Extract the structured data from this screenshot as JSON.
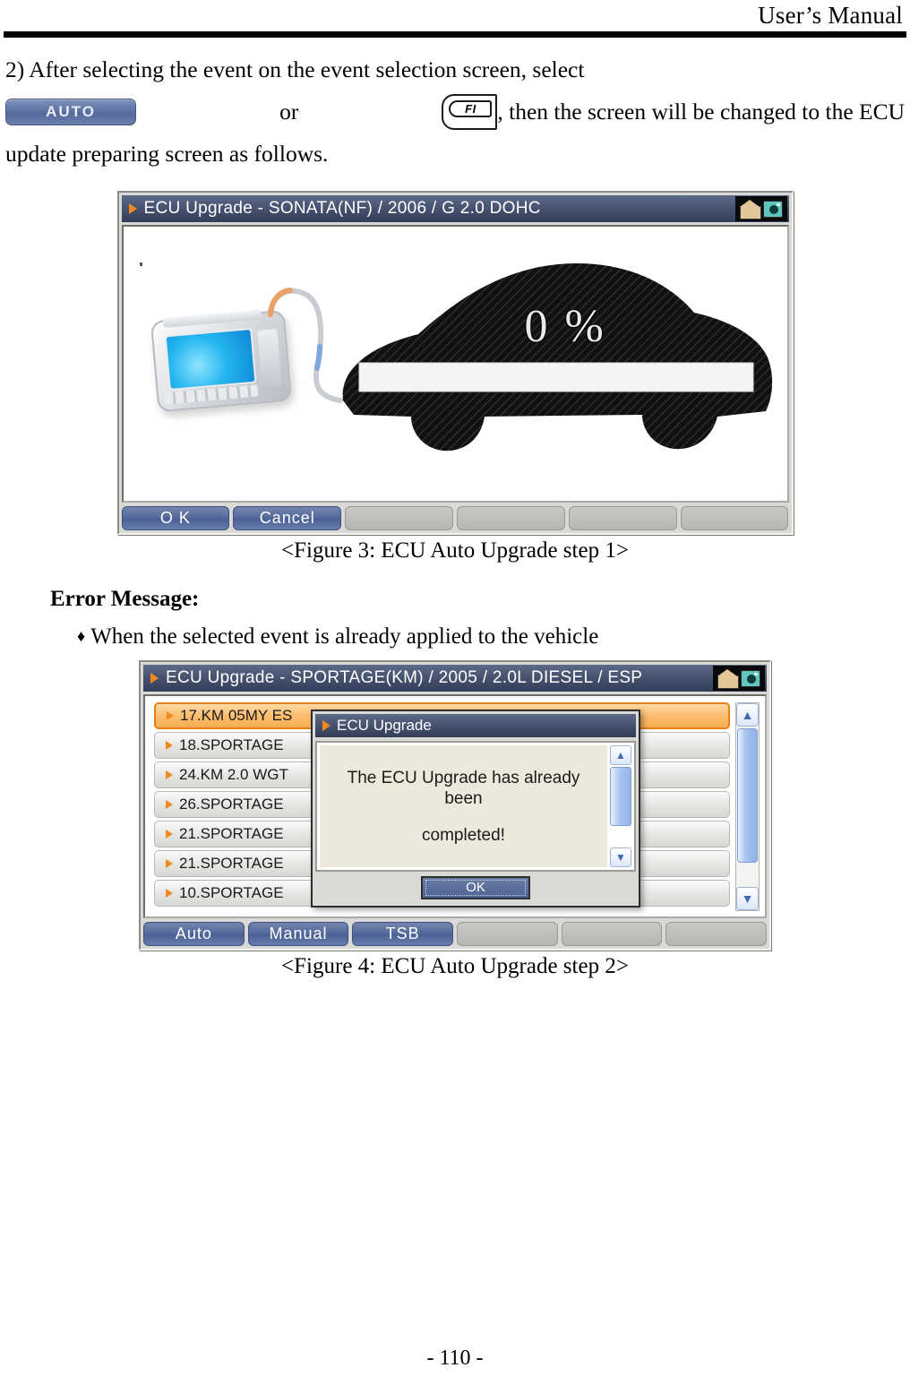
{
  "header": {
    "title": "User’s Manual"
  },
  "paragraph": {
    "line1_part1": "2) After  selecting  the  event  on  the  event  selection  screen,  select",
    "auto_button_label": "AUTO",
    "or_text": "or",
    "f1_key_label": "FI",
    "line2_after_key": ",  then  the  screen  will  be  changed  to  the  ECU",
    "line3": "update preparing screen as follows."
  },
  "figure3": {
    "caption": "<Figure 3: ECU Auto Upgrade step 1>",
    "window": {
      "title": "ECU Upgrade - SONATA(NF) / 2006 / G 2.0 DOHC",
      "titlebar_icons": [
        "home-icon",
        "camera-icon"
      ],
      "progress_percent_label": "0 %",
      "progress_value": 0,
      "buttons": [
        {
          "label": "O K",
          "enabled": true
        },
        {
          "label": "Cancel",
          "enabled": true
        },
        {
          "label": "",
          "enabled": false
        },
        {
          "label": "",
          "enabled": false
        },
        {
          "label": "",
          "enabled": false
        },
        {
          "label": "",
          "enabled": false
        }
      ]
    }
  },
  "error_section": {
    "heading": "Error Message:",
    "bullet_mark": "♦",
    "bullet_text": "When the selected event is already applied to the vehicle"
  },
  "figure4": {
    "caption": "<Figure 4: ECU Auto Upgrade step 2>",
    "window": {
      "title": "ECU Upgrade - SPORTAGE(KM) / 2005 / 2.0L DIESEL / ESP",
      "titlebar_icons": [
        "home-icon",
        "camera-icon"
      ],
      "list_items": [
        {
          "label": "17.KM 05MY ES",
          "selected": true
        },
        {
          "label": "18.SPORTAGE",
          "selected": false
        },
        {
          "label": "24.KM 2.0 WGT",
          "selected": false
        },
        {
          "label": "26.SPORTAGE",
          "selected": false
        },
        {
          "label": "21.SPORTAGE",
          "selected": false
        },
        {
          "label": "21.SPORTAGE",
          "selected": false
        },
        {
          "label": "10.SPORTAGE",
          "selected": false
        }
      ],
      "scrollbar": {
        "up": "▲",
        "down": "▼"
      },
      "dialog": {
        "title": "ECU Upgrade",
        "message_line1": "The ECU Upgrade has already been",
        "message_line2": "completed!",
        "ok_label": "OK",
        "scrollbar": {
          "up": "▲",
          "down": "▼"
        }
      },
      "buttons": [
        {
          "label": "Auto",
          "enabled": true
        },
        {
          "label": "Manual",
          "enabled": true
        },
        {
          "label": "TSB",
          "enabled": true
        },
        {
          "label": "",
          "enabled": false
        },
        {
          "label": "",
          "enabled": false
        },
        {
          "label": "",
          "enabled": false
        }
      ]
    }
  },
  "footer": {
    "page_number": "- 110 -"
  }
}
